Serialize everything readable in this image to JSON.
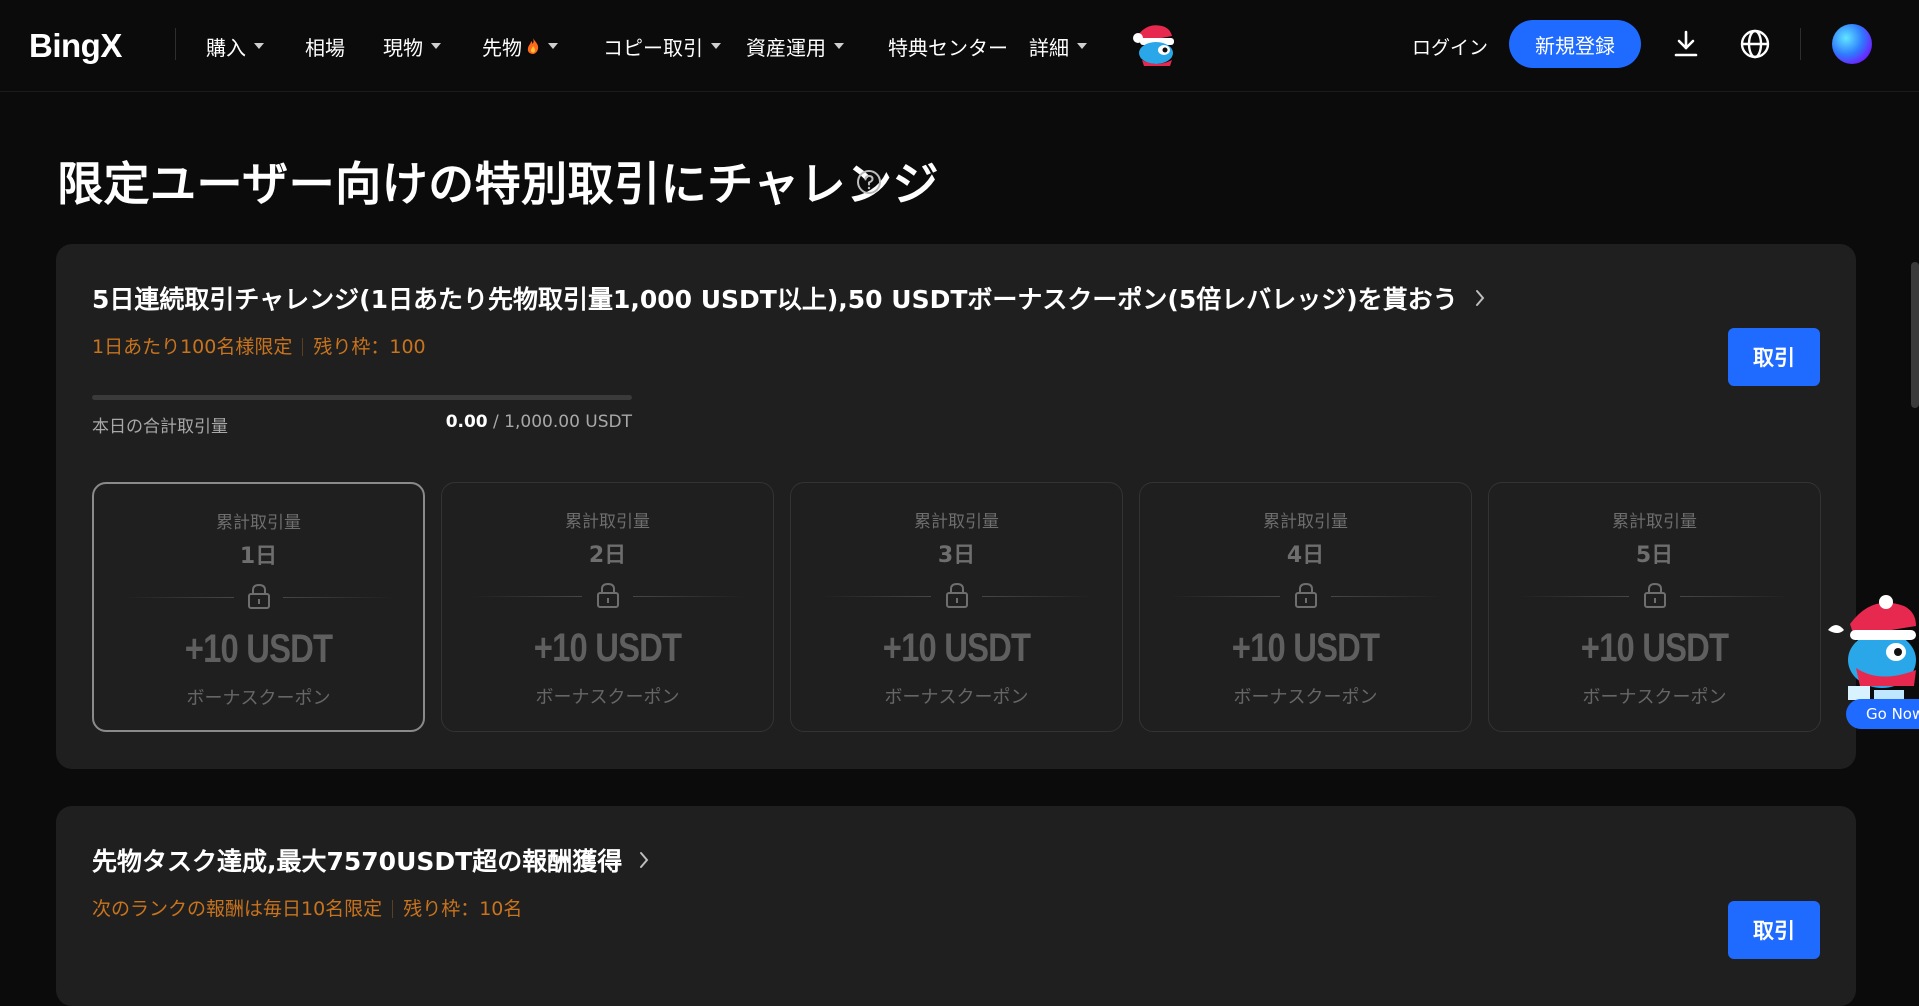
{
  "header": {
    "logo": "BingX",
    "nav": [
      {
        "label": "購入",
        "dropdown": true
      },
      {
        "label": "相場",
        "dropdown": false
      },
      {
        "label": "現物",
        "dropdown": true
      },
      {
        "label": "先物",
        "dropdown": true,
        "icon": "flame-icon"
      },
      {
        "label": "コピー取引",
        "dropdown": true
      },
      {
        "label": "資産運用",
        "dropdown": true
      },
      {
        "label": "特典センター",
        "dropdown": false
      },
      {
        "label": "詳細",
        "dropdown": true
      }
    ],
    "login_label": "ログイン",
    "signup_label": "新規登録",
    "icons": [
      "download-icon",
      "globe-icon"
    ]
  },
  "page": {
    "title": "限定ユーザー向けの特別取引にチャレンジ"
  },
  "challenge1": {
    "title": "5日連続取引チャレンジ(1日あたり先物取引量1,000 USDT以上),50 USDTボーナスクーポン(5倍レバレッジ)を貰おう",
    "limit": "1日あたり100名様限定",
    "remaining": "残り枠：100",
    "trade_label": "取引",
    "volume_label": "本日の合計取引量",
    "volume_current": "0.00",
    "volume_target": " / 1,000.00 USDT",
    "progress": 0,
    "days": [
      {
        "label": "累計取引量",
        "day": "1日",
        "reward": "+10 USDT",
        "coupon": "ボーナスクーポン",
        "active": true
      },
      {
        "label": "累計取引量",
        "day": "2日",
        "reward": "+10 USDT",
        "coupon": "ボーナスクーポン",
        "active": false
      },
      {
        "label": "累計取引量",
        "day": "3日",
        "reward": "+10 USDT",
        "coupon": "ボーナスクーポン",
        "active": false
      },
      {
        "label": "累計取引量",
        "day": "4日",
        "reward": "+10 USDT",
        "coupon": "ボーナスクーポン",
        "active": false
      },
      {
        "label": "累計取引量",
        "day": "5日",
        "reward": "+10 USDT",
        "coupon": "ボーナスクーポン",
        "active": false
      }
    ]
  },
  "challenge2": {
    "title": "先物タスク達成,最大7570USDT超の報酬獲得",
    "limit": "次のランクの報酬は毎日10名限定",
    "remaining": "残り枠：10名",
    "trade_label": "取引"
  },
  "floating": {
    "go_label": "Go Now"
  },
  "colors": {
    "accent": "#1f6aff",
    "warning": "#c8731d",
    "background": "#0b0b0b",
    "card": "#1f1f1f"
  }
}
